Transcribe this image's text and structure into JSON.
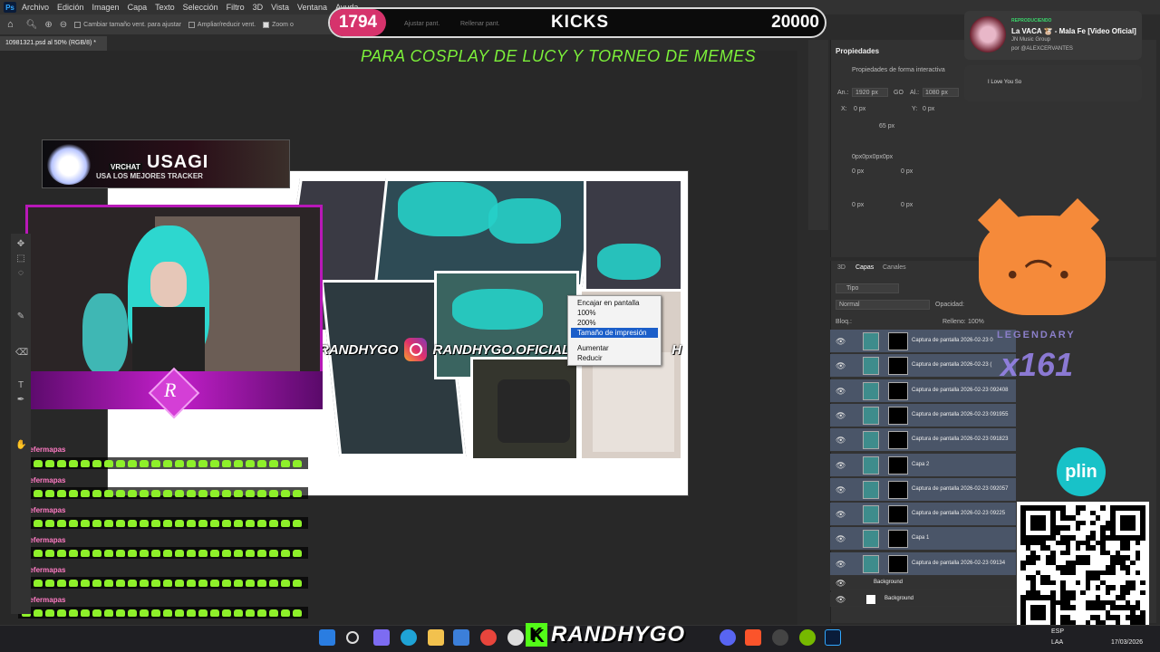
{
  "app": {
    "menu": [
      "Archivo",
      "Edición",
      "Imagen",
      "Capa",
      "Texto",
      "Selección",
      "Filtro",
      "3D",
      "Vista",
      "Ventana",
      "Ayuda"
    ],
    "options": {
      "resize_windows": "Cambiar tamaño vent. para ajustar",
      "zoom_windows": "Ampliar/reducir vent.",
      "zoom_all": "Zoom o",
      "fit_screen": "Ajustar pant.",
      "fill_screen": "Rellenar pant."
    },
    "doc_tab": "10981321.psd al 50% (RGB/8) *"
  },
  "stream": {
    "followers": "1794",
    "platform": "KICKS",
    "goal": "20000",
    "subtitle": "PARA COSPLAY DE LUCY Y TORNEO DE MEMES",
    "usagi": {
      "vrchat": "VRCHAT",
      "title": "USAGI",
      "subtitle": "USA LOS MEJORES TRACKER"
    },
    "instagram_handle": "RANDHYGO.OFICIAL",
    "handle_left": "RANDHYGO",
    "handle_right": "H",
    "cam_logo": "R",
    "chat_user": "sefermapas",
    "legendary": "LEGENDARY",
    "legendary_count": "x161",
    "plin": "plin",
    "brand": "RANDHYGO",
    "brand_k": "K"
  },
  "context_menu": {
    "items": [
      "Encajar en pantalla",
      "100%",
      "200%",
      "Tamaño de impresión",
      "Aumentar",
      "Reducir"
    ],
    "selected_index": 3
  },
  "properties": {
    "title": "Propiedades",
    "subtitle": "Propiedades de forma interactiva",
    "width": "1920 px",
    "height": "1080 px",
    "w_label": "An.:",
    "h_label": "Al.:",
    "go_label": "GO",
    "x_label": "X:",
    "y_label": "Y:",
    "x": "0 px",
    "y": "0 px",
    "stroke": "65 px",
    "radius": "0px0px0px0px",
    "r1": "0 px",
    "r2": "0 px",
    "r3": "0 px",
    "r4": "0 px"
  },
  "layers": {
    "tabs": [
      "3D",
      "Capas",
      "Canales"
    ],
    "filter": "Tipo",
    "blend": "Normal",
    "opacity_label": "Opacidad:",
    "lock_label": "Bloq.:",
    "fill_label": "Relleno:",
    "fill_value": "100%",
    "items": [
      "Captura de pantalla 2026-02-23 0",
      "Captura de pantalla 2026-02-23 (",
      "Captura de pantalla 2026-02-23 092408",
      "Captura de pantalla 2026-02-23 091955",
      "Captura de pantalla 2026-02-23 091823",
      "Capa 2",
      "Captura de pantalla 2026-02-23 092057",
      "Captura de pantalla 2026-02-23 09225",
      "Capa 1",
      "Captura de pantalla 2026-02-23 09134"
    ],
    "group": "Background",
    "background": "Background"
  },
  "notification": {
    "tag": "REPRODUCIENDO",
    "title": "La VACA 🐮 - Mala Fe [Video Oficial]",
    "artist": "JN Music Group",
    "user": "por @ALEXCERVANTES",
    "secondary": "I Love You So"
  },
  "taskbar": {
    "lang1": "ESP",
    "lang2": "LAA",
    "time": "",
    "date": "17/03/2026"
  },
  "colors": {
    "accent_green": "#7cf03a",
    "kick_green": "#53fc18",
    "pink": "#d6336c",
    "magenta": "#c21fc9",
    "selection_blue": "#1b5ec9"
  }
}
